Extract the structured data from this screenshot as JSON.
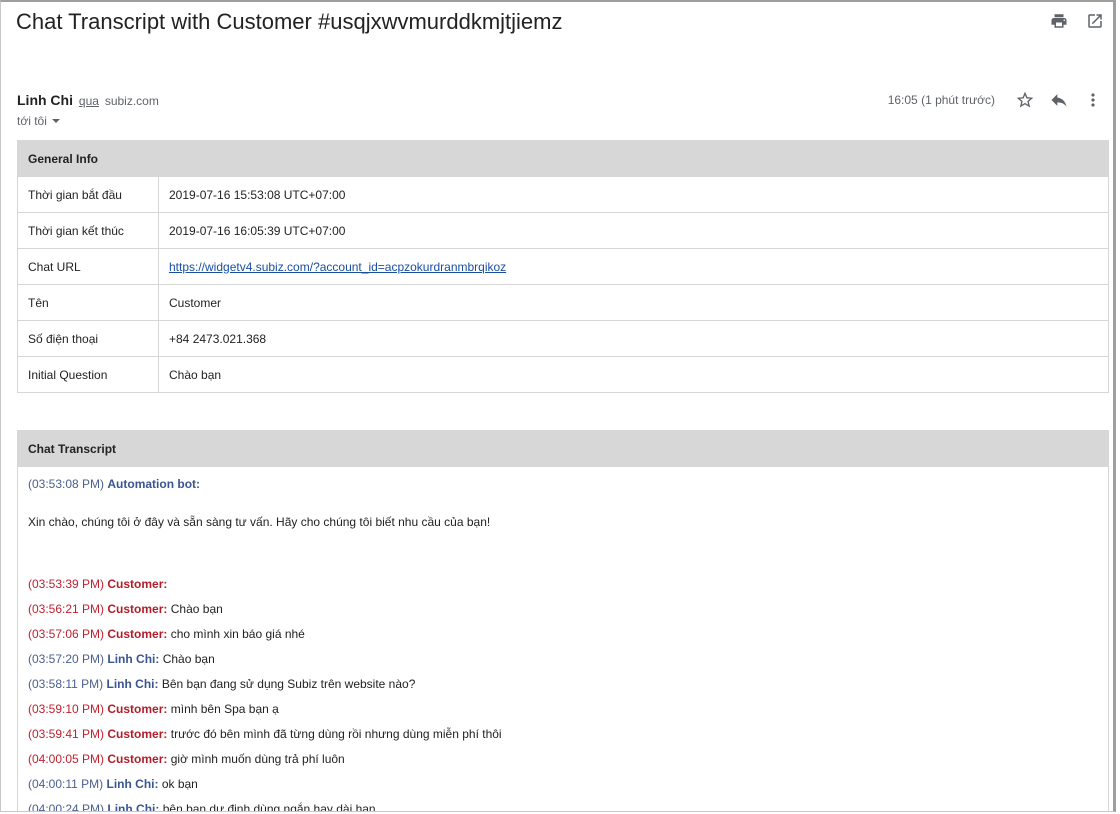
{
  "email": {
    "subject": "Chat Transcript with Customer #usqjxwvmurddkmjtjiemz",
    "sender_name": "Linh Chi",
    "via_label": "qua",
    "via_domain": "subiz.com",
    "to_label": "tới tôi",
    "time": "16:05 (1 phút trước)"
  },
  "icons": {
    "print": "print-icon",
    "open_new_window": "open-in-new-window-icon",
    "star": "star-icon",
    "reply": "reply-icon",
    "more": "more-vert-icon",
    "dropdown": "caret-down-icon"
  },
  "general_info": {
    "title": "General Info",
    "rows": [
      {
        "key": "Thời gian bắt đầu",
        "value": "2019-07-16 15:53:08 UTC+07:00"
      },
      {
        "key": "Thời gian kết thúc",
        "value": "2019-07-16 16:05:39 UTC+07:00"
      },
      {
        "key": "Chat URL",
        "value": "https://widgetv4.subiz.com/?account_id=acpzokurdranmbrqikoz"
      },
      {
        "key": "Tên",
        "value": "Customer"
      },
      {
        "key": "Số điện thoại",
        "value": "+84 2473.021.368"
      },
      {
        "key": "Initial Question",
        "value": "Chào bạn"
      }
    ]
  },
  "transcript": {
    "title": "Chat Transcript",
    "bot_time": "(03:53:08 PM)",
    "bot_name": "Automation bot:",
    "bot_message": "Xin chào, chúng tôi ở đây và sẵn sàng tư vấn. Hãy cho chúng tôi biết nhu cầu của bạn!",
    "messages": [
      {
        "time": "(03:53:39 PM)",
        "speaker": "Customer:",
        "text": ""
      },
      {
        "time": "(03:56:21 PM)",
        "speaker": "Customer:",
        "text": "Chào bạn"
      },
      {
        "time": "(03:57:06 PM)",
        "speaker": "Customer:",
        "text": "cho mình xin báo giá nhé"
      },
      {
        "time": "(03:57:20 PM)",
        "speaker": "Linh Chi:",
        "text": "Chào bạn"
      },
      {
        "time": "(03:58:11 PM)",
        "speaker": "Linh Chi:",
        "text": "Bên bạn đang sử dụng Subiz trên website nào?"
      },
      {
        "time": "(03:59:10 PM)",
        "speaker": "Customer:",
        "text": "mình bên Spa bạn ạ"
      },
      {
        "time": "(03:59:41 PM)",
        "speaker": "Customer:",
        "text": "trước đó bên mình đã từng dùng rồi nhưng dùng miễn phí thôi"
      },
      {
        "time": "(04:00:05 PM)",
        "speaker": "Customer:",
        "text": "giờ mình muốn dùng trả phí luôn"
      },
      {
        "time": "(04:00:11 PM)",
        "speaker": "Linh Chi:",
        "text": "ok bạn"
      },
      {
        "time": "(04:00:24 PM)",
        "speaker": "Linh Chi:",
        "text": "bên bạn dự định dùng ngắn hay dài hạn"
      }
    ]
  }
}
